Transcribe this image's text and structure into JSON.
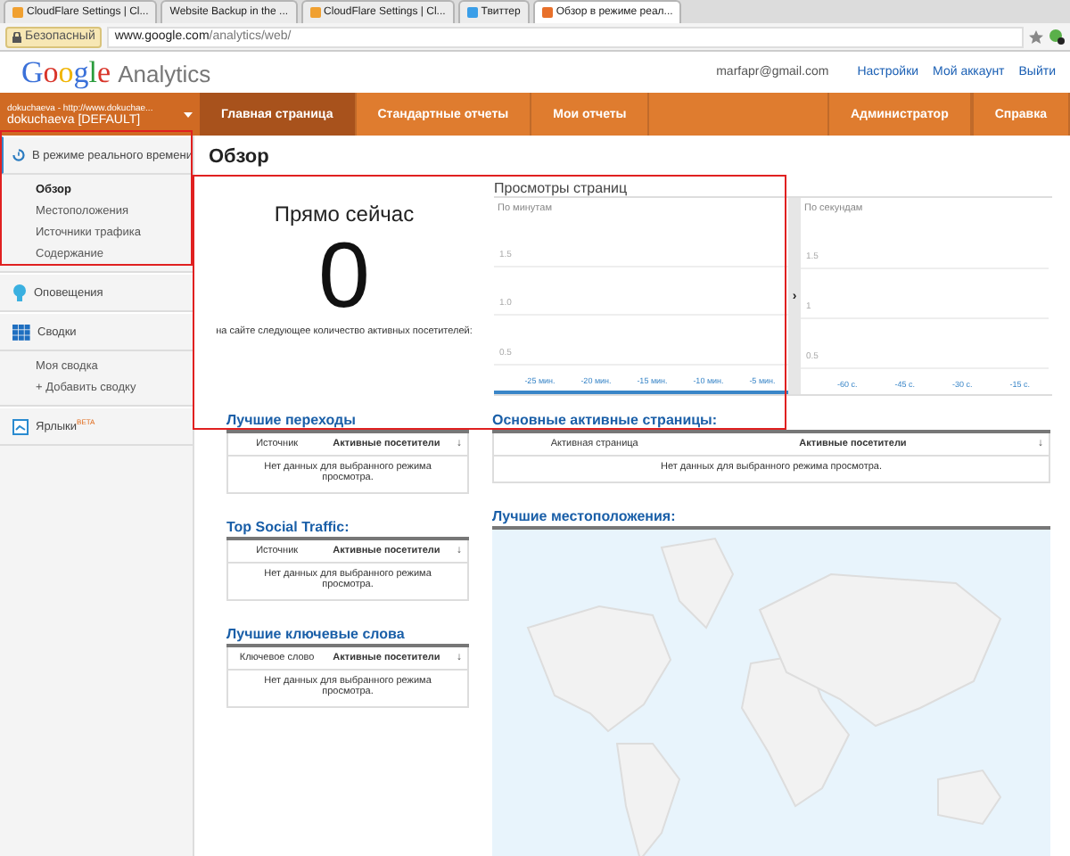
{
  "browser": {
    "tabs": [
      {
        "label": "CloudFlare Settings | Cl...",
        "selected": false,
        "color": "#f0a030"
      },
      {
        "label": "Website Backup in the ...",
        "selected": false
      },
      {
        "label": "CloudFlare Settings | Cl...",
        "selected": false,
        "color": "#f0a030"
      },
      {
        "label": "Твиттер",
        "selected": false,
        "color": "#3a9ee8"
      },
      {
        "label": "Обзор в режиме реал...",
        "selected": true,
        "color": "#e8702a"
      }
    ],
    "security_badge": "Безопасный",
    "url_host": "www.google.com",
    "url_path": "/analytics/web/"
  },
  "header": {
    "logo": [
      "Google",
      "Analytics"
    ],
    "email": "marfapr@gmail.com",
    "links": [
      "Настройки",
      "Мой аккаунт",
      "Выйти"
    ]
  },
  "nav": {
    "account": [
      "dokuchaeva - http://www.dokuchae...",
      "dokuchaeva [DEFAULT]"
    ],
    "tabs": [
      {
        "label": "Главная страница",
        "selected": true
      },
      {
        "label": "Стандартные отчеты",
        "selected": false
      },
      {
        "label": "Мои отчеты",
        "selected": false
      }
    ],
    "right": [
      "Администратор",
      "Справка"
    ]
  },
  "sidebar": [
    {
      "kind": "realtime",
      "label": "В режиме реального времени",
      "items": [
        {
          "label": "Обзор",
          "selected": true
        },
        {
          "label": "Местоположения",
          "selected": false
        },
        {
          "label": "Источники трафика",
          "selected": false
        },
        {
          "label": "Содержание",
          "selected": false
        }
      ]
    },
    {
      "kind": "alerts",
      "label": "Оповещения"
    },
    {
      "kind": "dashboards",
      "label": "Сводки",
      "items": [
        {
          "label": "Моя сводка",
          "selected": false
        },
        {
          "label": "+ Добавить сводку",
          "selected": false
        }
      ]
    },
    {
      "kind": "shortcuts",
      "label": "Ярлыки",
      "badge": "BETA"
    }
  ],
  "page_title": "Обзор",
  "now": {
    "title": "Прямо сейчас",
    "count": "0",
    "caption": "на сайте следующее количество активных посетителей:"
  },
  "pageviews": {
    "title": "Просмотры страниц",
    "panels": [
      {
        "title": "По минутам",
        "y_labels": [
          "1.5",
          "1.0",
          "0.5"
        ],
        "x_labels": [
          "-25 мин.",
          "-20 мин.",
          "-15 мин.",
          "-10 мин.",
          "-5 мин."
        ]
      },
      {
        "title": "По секундам",
        "y_labels": [
          "1.5",
          "1",
          "0.5"
        ],
        "x_labels": [
          "-60 с.",
          "-45 с.",
          "-30 с.",
          "-15 с."
        ]
      }
    ],
    "toggle": "›"
  },
  "left_tables": [
    {
      "title": "Лучшие переходы",
      "columns": [
        "Источник",
        "Активные посетители"
      ],
      "empty": "Нет данных для выбранного режима просмотра."
    },
    {
      "title": "Top Social Traffic:",
      "columns": [
        "Источник",
        "Активные посетители"
      ],
      "empty": "Нет данных для выбранного режима просмотра."
    },
    {
      "title": "Лучшие ключевые слова",
      "columns": [
        "Ключевое слово",
        "Активные посетители"
      ],
      "empty": "Нет данных для выбранного режима просмотра."
    }
  ],
  "pages_table": {
    "title": "Основные активные страницы:",
    "columns": [
      "Активная страница",
      "Активные посетители"
    ],
    "empty": "Нет данных для выбранного режима просмотра."
  },
  "locations": {
    "title": "Лучшие местоположения:"
  },
  "sort_mark": "↓"
}
